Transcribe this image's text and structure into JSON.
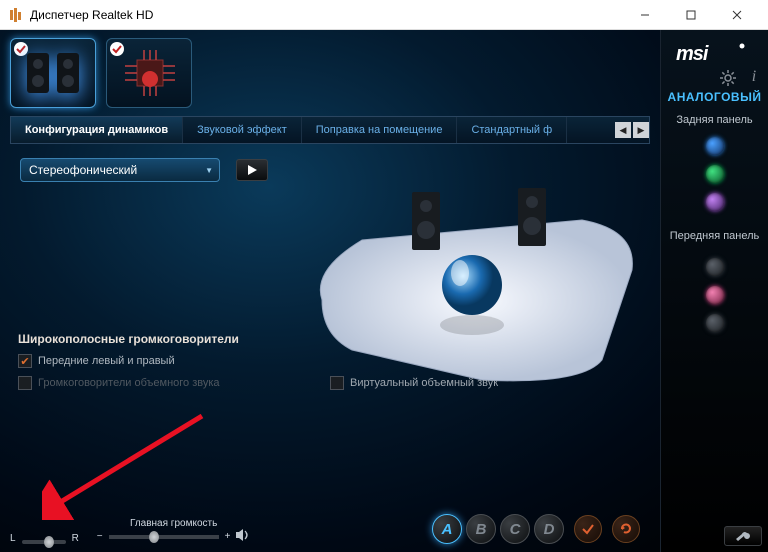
{
  "window": {
    "title": "Диспетчер Realtek HD"
  },
  "tabs": {
    "items": [
      "Конфигурация динамиков",
      "Звуковой эффект",
      "Поправка на помещение",
      "Стандартный ф"
    ],
    "activeIndex": 0
  },
  "config": {
    "mode": "Стереофонический"
  },
  "broadband": {
    "title": "Широкополосные громкоговорители",
    "front": "Передние левый и правый",
    "surround": "Громкоговорители объемного звука"
  },
  "virtual": {
    "label": "Виртуальный объемный звук"
  },
  "volume": {
    "balanceLeft": "L",
    "balanceRight": "R",
    "mainLabel": "Главная громкость",
    "minus": "−",
    "plus": "+"
  },
  "presetButtons": [
    "A",
    "B",
    "C",
    "D"
  ],
  "rightPanel": {
    "brand": "msi",
    "modeTitle": "АНАЛОГОВЫЙ",
    "rear": "Задняя панель",
    "front": "Передняя панель"
  }
}
